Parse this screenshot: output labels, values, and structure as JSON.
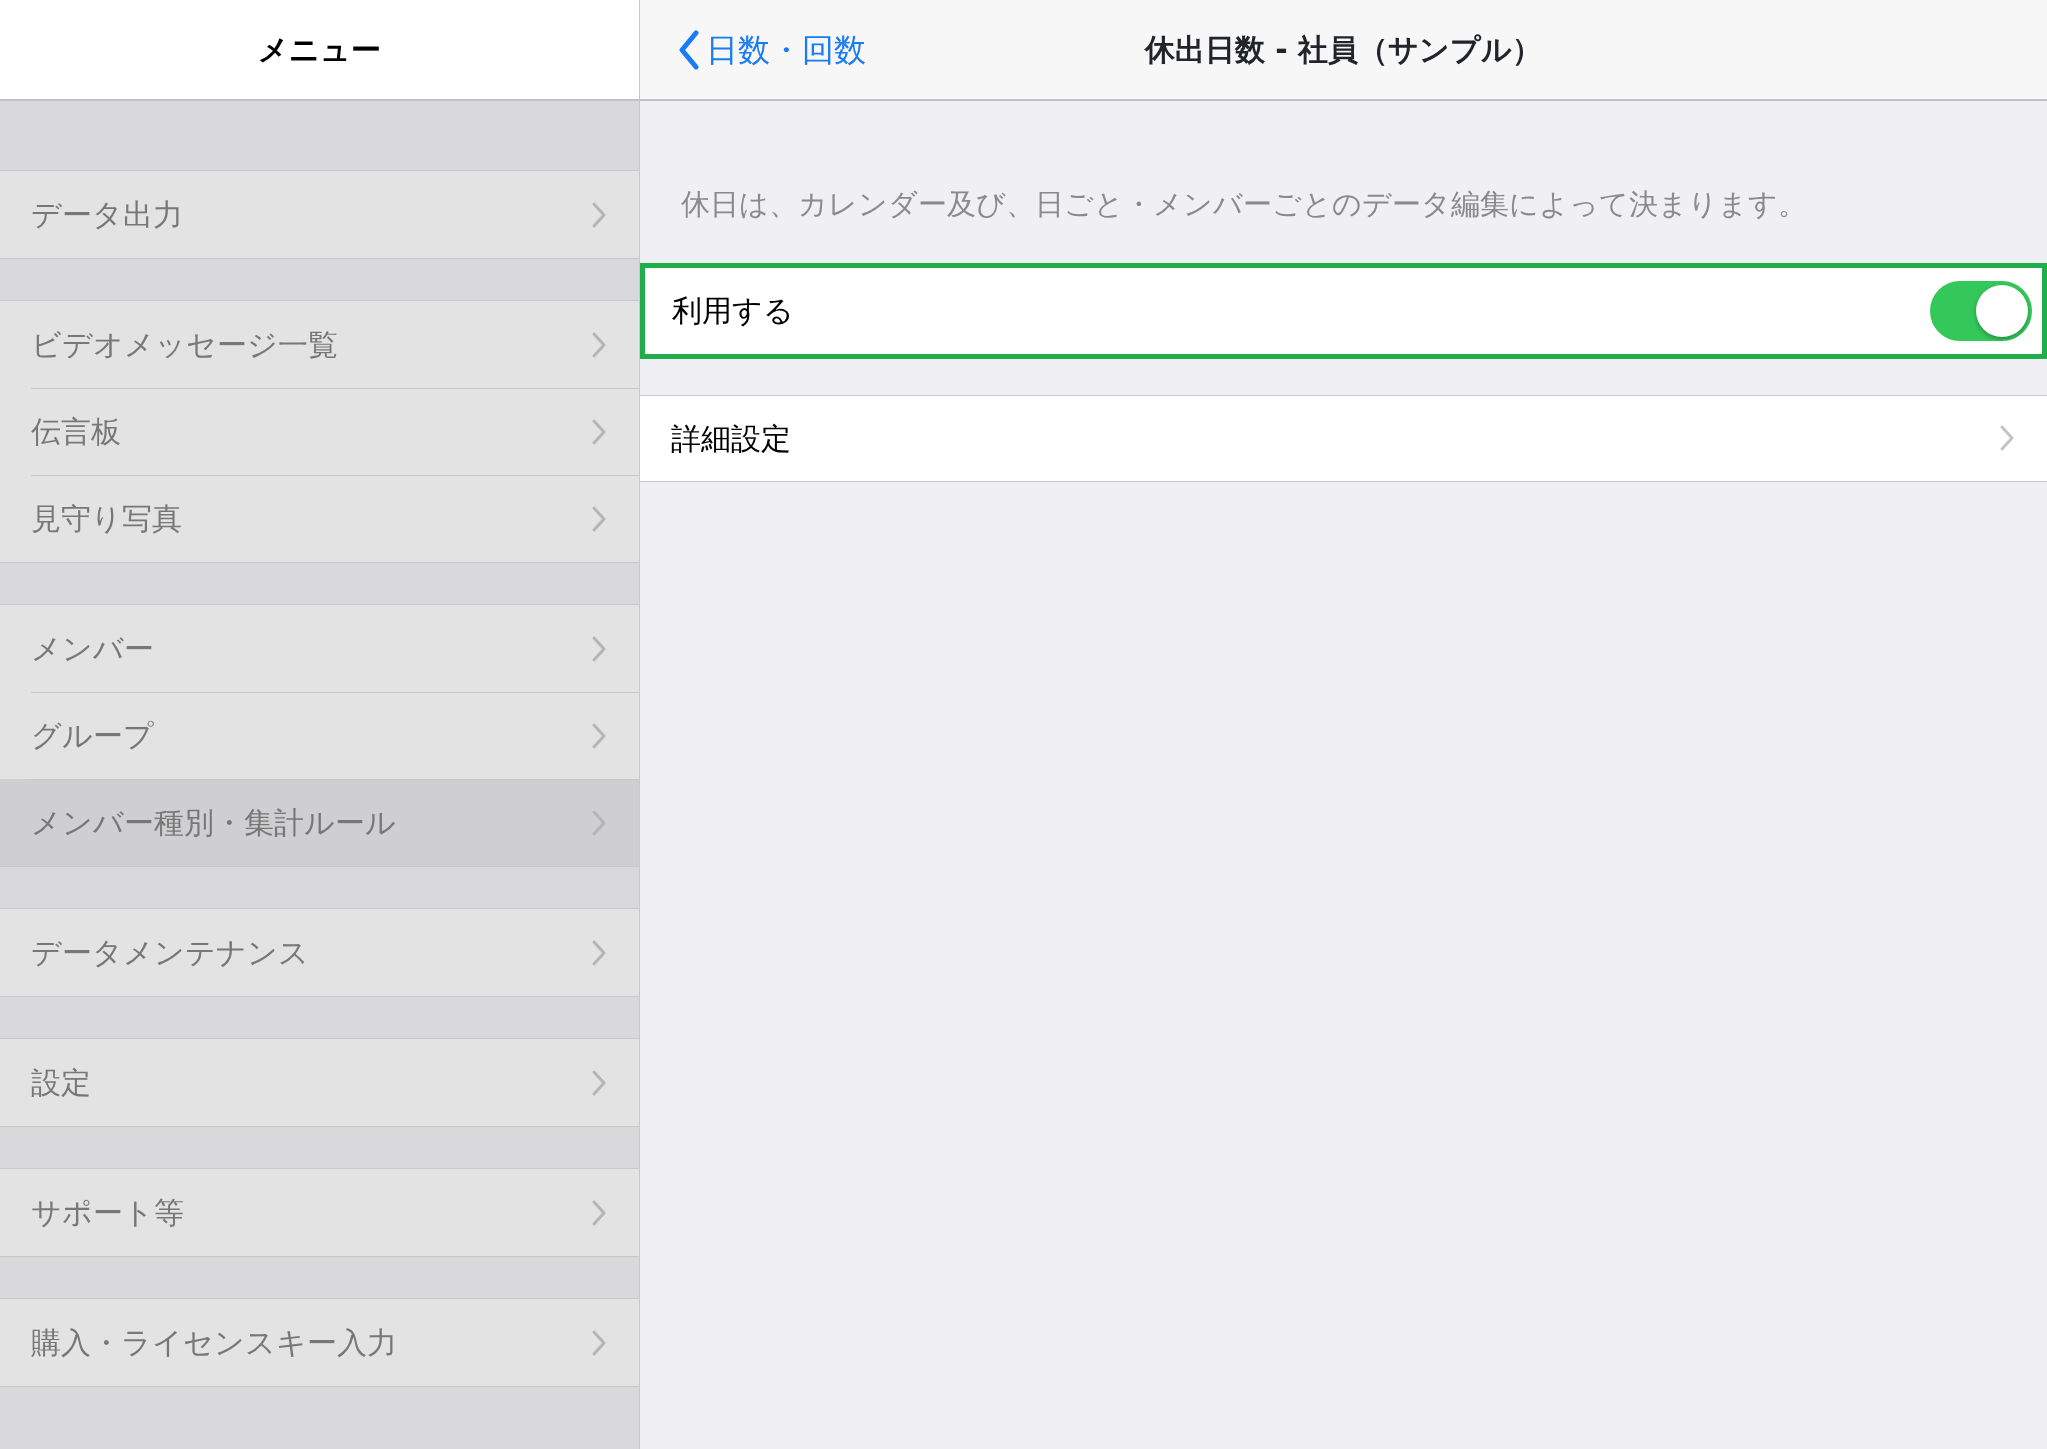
{
  "sidebar": {
    "title": "メニュー",
    "groups": [
      {
        "items": [
          {
            "label": "データ出力",
            "selected": false
          }
        ]
      },
      {
        "items": [
          {
            "label": "ビデオメッセージ一覧",
            "selected": false
          },
          {
            "label": "伝言板",
            "selected": false
          },
          {
            "label": "見守り写真",
            "selected": false
          }
        ]
      },
      {
        "items": [
          {
            "label": "メンバー",
            "selected": false
          },
          {
            "label": "グループ",
            "selected": false
          },
          {
            "label": "メンバー種別・集計ルール",
            "selected": true
          }
        ]
      },
      {
        "items": [
          {
            "label": "データメンテナンス",
            "selected": false
          }
        ]
      },
      {
        "items": [
          {
            "label": "設定",
            "selected": false
          }
        ]
      },
      {
        "items": [
          {
            "label": "サポート等",
            "selected": false
          }
        ]
      },
      {
        "items": [
          {
            "label": "購入・ライセンスキー入力",
            "selected": false
          }
        ]
      }
    ]
  },
  "detail": {
    "back_label": "日数・回数",
    "title": "休出日数 - 社員（サンプル）",
    "note": "休日は、カレンダー及び、日ごと・メンバーごとのデータ編集によって決まります。",
    "rows": [
      {
        "kind": "toggle",
        "label": "利用する",
        "on": true,
        "highlighted": true
      },
      {
        "kind": "link",
        "label": "詳細設定",
        "highlighted": false
      }
    ]
  }
}
